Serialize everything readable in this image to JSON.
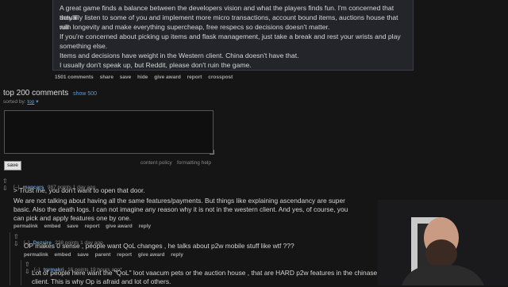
{
  "post": {
    "paragraphs": [
      "A great game finds a balance between the developers vision and what the players finds fun. I'm concerned that they'll",
      "actually listen to some of you and implement more micro transactions, account bound items, auctions house that will",
      "ruin longevity and make everything supercheap, free respecs so decisions doesn't matter.",
      "If you're concerned about picking up items and flask management, just take a break and rest your wrists and play",
      "something else.",
      "Items and decisions have weight in the Western client. China doesn't have that.",
      "I usually don't speak up, but Reddit, please don't ruin the game."
    ],
    "actions": [
      "1501 comments",
      "share",
      "save",
      "hide",
      "give award",
      "report",
      "crosspost"
    ]
  },
  "comments_header": {
    "title": "top 200 comments",
    "show_link": "show 500",
    "sorted_by_label": "sorted by:",
    "sort_value": "top"
  },
  "comment_form": {
    "save_label": "save",
    "content_policy": "content policy",
    "formatting_help": "formatting help"
  },
  "comments": [
    {
      "toggle": "[–]",
      "author": "mapcars",
      "meta": "987 points 1 day ago",
      "lines": [
        "> Trust me, you don't want to open that door.",
        "We are not talking about having all the same features/payments. But things like explaining ascendancy are super",
        "basic. Also the death logs. I can not imagine any reason why it is not in the western client. And yes, of course, you",
        "can pick and apply features one by one."
      ],
      "actions": [
        "permalink",
        "embed",
        "save",
        "report",
        "give award",
        "reply"
      ]
    },
    {
      "toggle": "[–]",
      "author": "Dezsire",
      "meta": "238 points 1 day ago",
      "lines": [
        "OP makes 0 sense , people want QoL changes , he talks about p2w mobile stuff like wtf ???"
      ],
      "actions": [
        "permalink",
        "embed",
        "save",
        "parent",
        "report",
        "give award",
        "reply"
      ]
    },
    {
      "toggle": "[–]",
      "author": "tormakri",
      "meta": "16 points 19 hours ago*",
      "lines": [
        "Lot of people here want the \"QoL\" loot vaacum pets or the auction house , that are HARD p2w features in the chinase",
        "client. This is why Op is afraid and lot of others."
      ]
    }
  ],
  "webcam": {
    "label": "streamer webcam"
  }
}
